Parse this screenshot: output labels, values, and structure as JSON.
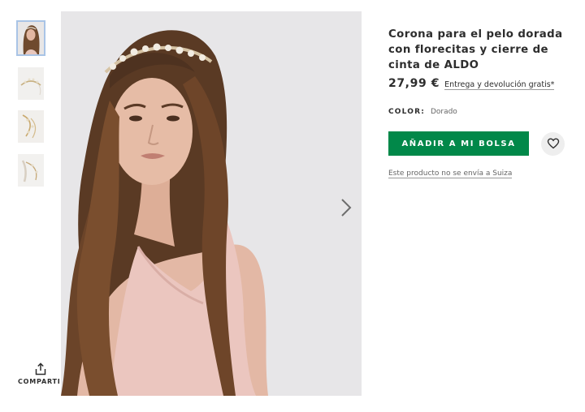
{
  "product": {
    "title": "Corona para el pelo dorada con florecitas y cierre de cinta de ALDO",
    "price": "27,99 €",
    "delivery_link": "Entrega y devolución gratis*",
    "color_label": "COLOR:",
    "color_value": "Dorado",
    "add_to_bag_label": "AÑADIR A MI BOLSA",
    "shipping_note": "Este producto no se envía a Suiza"
  },
  "gallery": {
    "thumbnail_count": 4,
    "selected_thumbnail": 1,
    "share_label": "COMPARTIR",
    "next_icon": "chevron-right-icon",
    "share_icon": "share-icon",
    "save_icon": "heart-icon"
  },
  "colors": {
    "add_to_bag": "#018849",
    "text": "#2d2d2d",
    "muted": "#666666",
    "selected_outline": "#a9c4e6"
  }
}
